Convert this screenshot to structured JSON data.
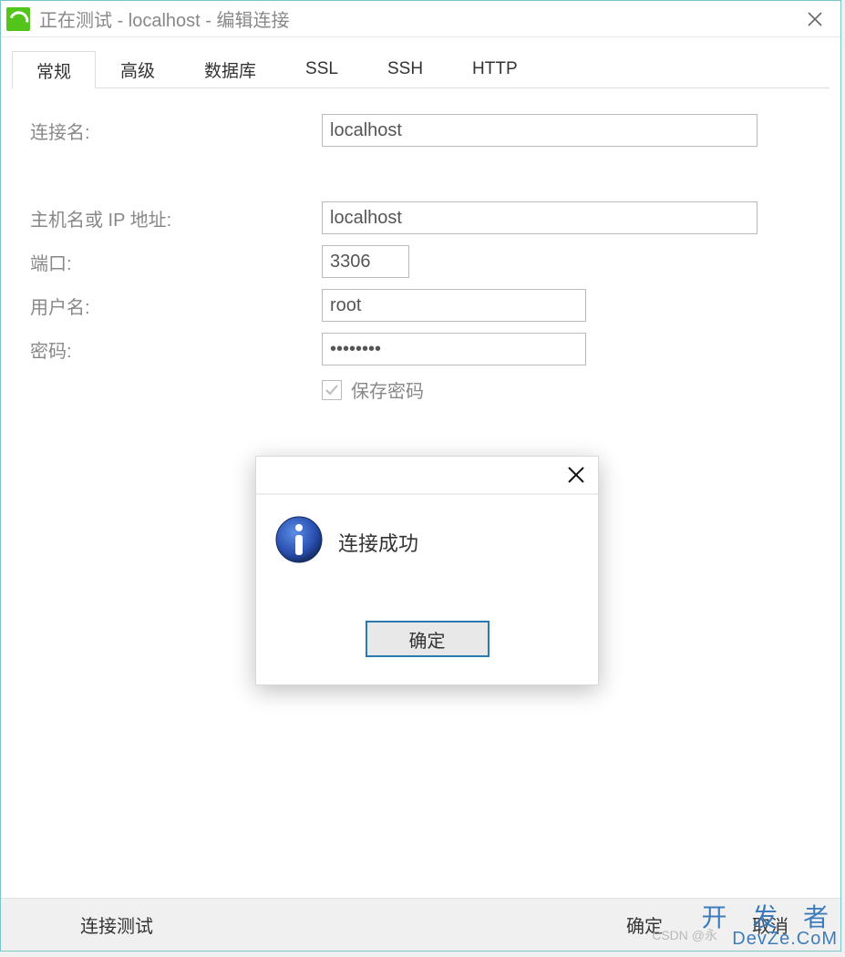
{
  "window": {
    "title": "正在测试 - localhost - 编辑连接"
  },
  "tabs": [
    {
      "label": "常规",
      "active": true
    },
    {
      "label": "高级",
      "active": false
    },
    {
      "label": "数据库",
      "active": false
    },
    {
      "label": "SSL",
      "active": false
    },
    {
      "label": "SSH",
      "active": false
    },
    {
      "label": "HTTP",
      "active": false
    }
  ],
  "form": {
    "connection_name_label": "连接名:",
    "connection_name_value": "localhost",
    "host_label": "主机名或 IP 地址:",
    "host_value": "localhost",
    "port_label": "端口:",
    "port_value": "3306",
    "username_label": "用户名:",
    "username_value": "root",
    "password_label": "密码:",
    "password_value": "••••••••",
    "save_password_label": "保存密码",
    "save_password_checked": true
  },
  "footer": {
    "test_label": "连接测试",
    "ok_label": "确定",
    "cancel_label": "取消"
  },
  "modal": {
    "message": "连接成功",
    "ok_label": "确定",
    "icon": "info-icon"
  },
  "watermark": {
    "main": "开 发 者",
    "sub": "DevZe.CoM",
    "csdn": "CSDN @永"
  }
}
